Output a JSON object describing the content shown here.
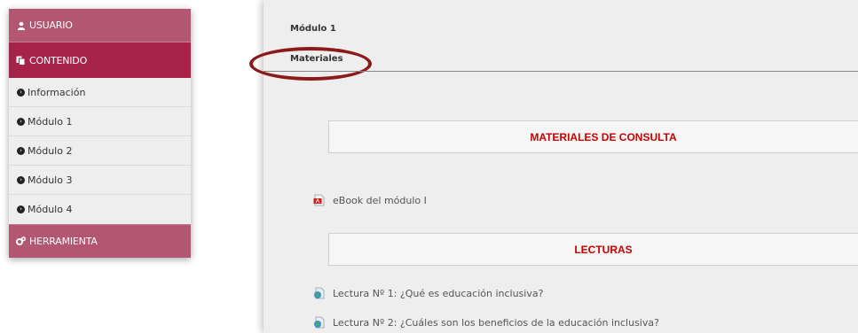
{
  "sidebar": {
    "user_label": "USUARIO",
    "content_label": "CONTENIDO",
    "items": [
      {
        "label": "Información"
      },
      {
        "label": "Módulo 1"
      },
      {
        "label": "Módulo 2"
      },
      {
        "label": "Módulo 3"
      },
      {
        "label": "Módulo 4"
      }
    ],
    "tools_label": "HERRAMIENTA",
    "icons": {
      "user": "user-icon",
      "content": "copy-icon",
      "item": "chevron-circle-right-icon",
      "tools": "cogs-icon"
    }
  },
  "main": {
    "breadcrumb": "Módulo 1",
    "active_tab": "Materiales",
    "sections": {
      "consulta_title": "MATERIALES DE CONSULTA",
      "lecturas_title": "LECTURAS"
    },
    "resources": {
      "ebook": "eBook del módulo I",
      "reading_1": "Lectura Nº 1: ¿Qué es educación inclusiva?",
      "reading_2": "Lectura Nº 2: ¿Cuáles son los beneficios de la educación inclusiva?"
    }
  },
  "colors": {
    "sidebar_header": "#b35671",
    "sidebar_active": "#a8234a",
    "section_title": "#c40000",
    "highlight_oval": "#8b1a1a"
  }
}
